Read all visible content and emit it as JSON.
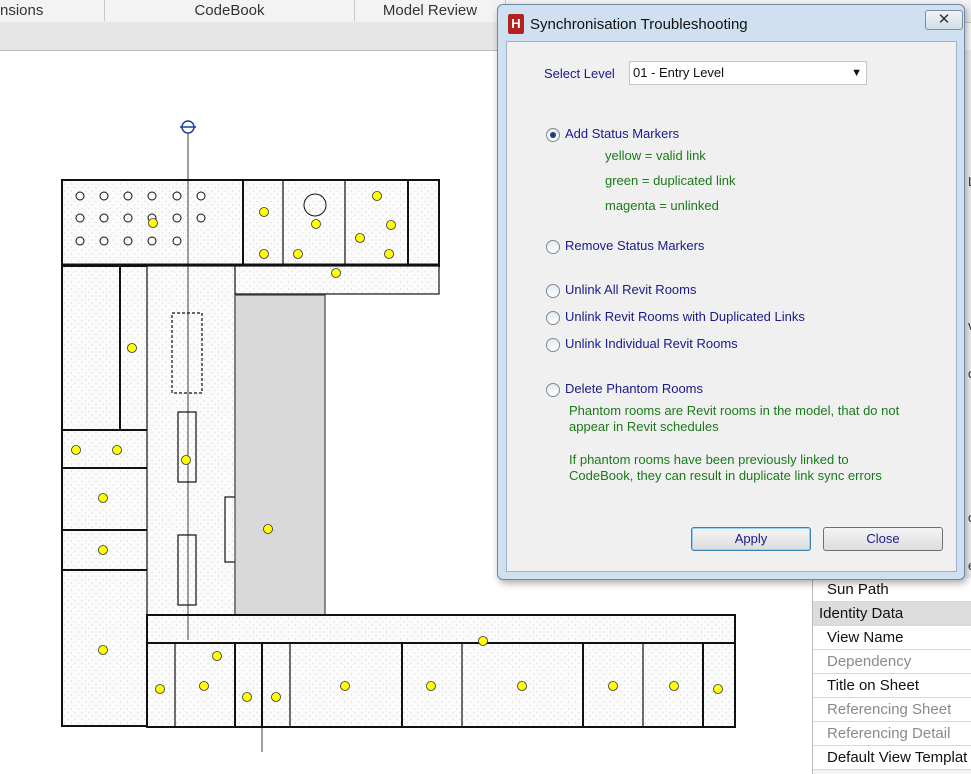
{
  "ribbon": {
    "tabs": [
      "nsions",
      "CodeBook",
      "Model Review"
    ]
  },
  "properties_panel": {
    "edge_chars": [
      "Le",
      "v.",
      "o",
      "o",
      "e"
    ],
    "rows": [
      {
        "label": "Sun Path",
        "state": "normal"
      },
      {
        "label": "Identity Data",
        "state": "header"
      },
      {
        "label": "View Name",
        "state": "normal"
      },
      {
        "label": "Dependency",
        "state": "dim"
      },
      {
        "label": "Title on Sheet",
        "state": "normal"
      },
      {
        "label": "Referencing Sheet",
        "state": "dim"
      },
      {
        "label": "Referencing Detail",
        "state": "dim"
      },
      {
        "label": "Default View Templat",
        "state": "normal"
      }
    ]
  },
  "dialog": {
    "title": "Synchronisation Troubleshooting",
    "logo_letter": "H",
    "close_glyph": "✕",
    "select_level_label": "Select Level",
    "select_level_value": "01 - Entry Level",
    "dropdown_arrow": "▼",
    "options": [
      {
        "label": "Add Status Markers",
        "selected": true
      },
      {
        "label": "Remove Status Markers",
        "selected": false
      },
      {
        "label": "Unlink All Revit Rooms",
        "selected": false
      },
      {
        "label": "Unlink Revit Rooms with Duplicated Links",
        "selected": false
      },
      {
        "label": "Unlink Individual Revit Rooms",
        "selected": false
      },
      {
        "label": "Delete Phantom Rooms",
        "selected": false
      }
    ],
    "legend": [
      "yellow = valid link",
      "green = duplicated link",
      "magenta = unlinked"
    ],
    "phantom_note_1": "Phantom rooms are Revit rooms in the model, that do not appear in Revit schedules",
    "phantom_note_2": "If phantom rooms have been previously linked to CodeBook, they can result in duplicate link sync errors",
    "apply_label": "Apply",
    "close_label": "Close"
  },
  "colors": {
    "marker_yellow": "#ffff00",
    "dialog_frame": "#cfe0f1",
    "label_blue": "#1a1a8c",
    "note_green": "#1a7a1a"
  }
}
